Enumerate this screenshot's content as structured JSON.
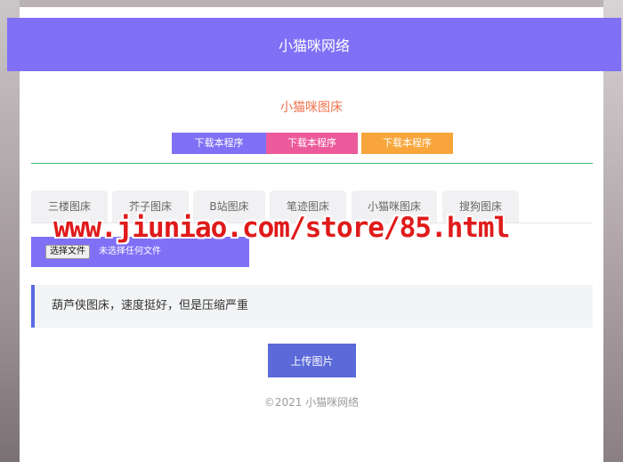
{
  "header": {
    "title": "小猫咪网络"
  },
  "app": {
    "subtitle": "小猫咪图床"
  },
  "download_buttons": [
    {
      "label": "下载本程序",
      "color": "#7f70f6"
    },
    {
      "label": "下载本程序",
      "color": "#ec5a9c"
    },
    {
      "label": "下载本程序",
      "color": "#f8a63b"
    }
  ],
  "tabs": [
    {
      "label": "三楼图床"
    },
    {
      "label": "芥子图床"
    },
    {
      "label": "B站图床"
    },
    {
      "label": "笔迹图床"
    },
    {
      "label": "小猫咪图床"
    },
    {
      "label": "搜狗图床"
    }
  ],
  "file_input": {
    "button_label": "选择文件",
    "status": "未选择任何文件"
  },
  "notice": {
    "text": "葫芦侠图床，速度挺好，但是压缩严重"
  },
  "upload_button": {
    "label": "上传图片"
  },
  "footer": {
    "text": "©2021 小猫咪网络"
  },
  "watermark": {
    "text": "www.jiuniao.com/store/85.html"
  },
  "colors": {
    "accent": "#7f70f6",
    "divider": "#2ebd7a",
    "subtitle": "#f0714c",
    "notice_border": "#5b6be2",
    "upload": "#5b6ad8"
  }
}
